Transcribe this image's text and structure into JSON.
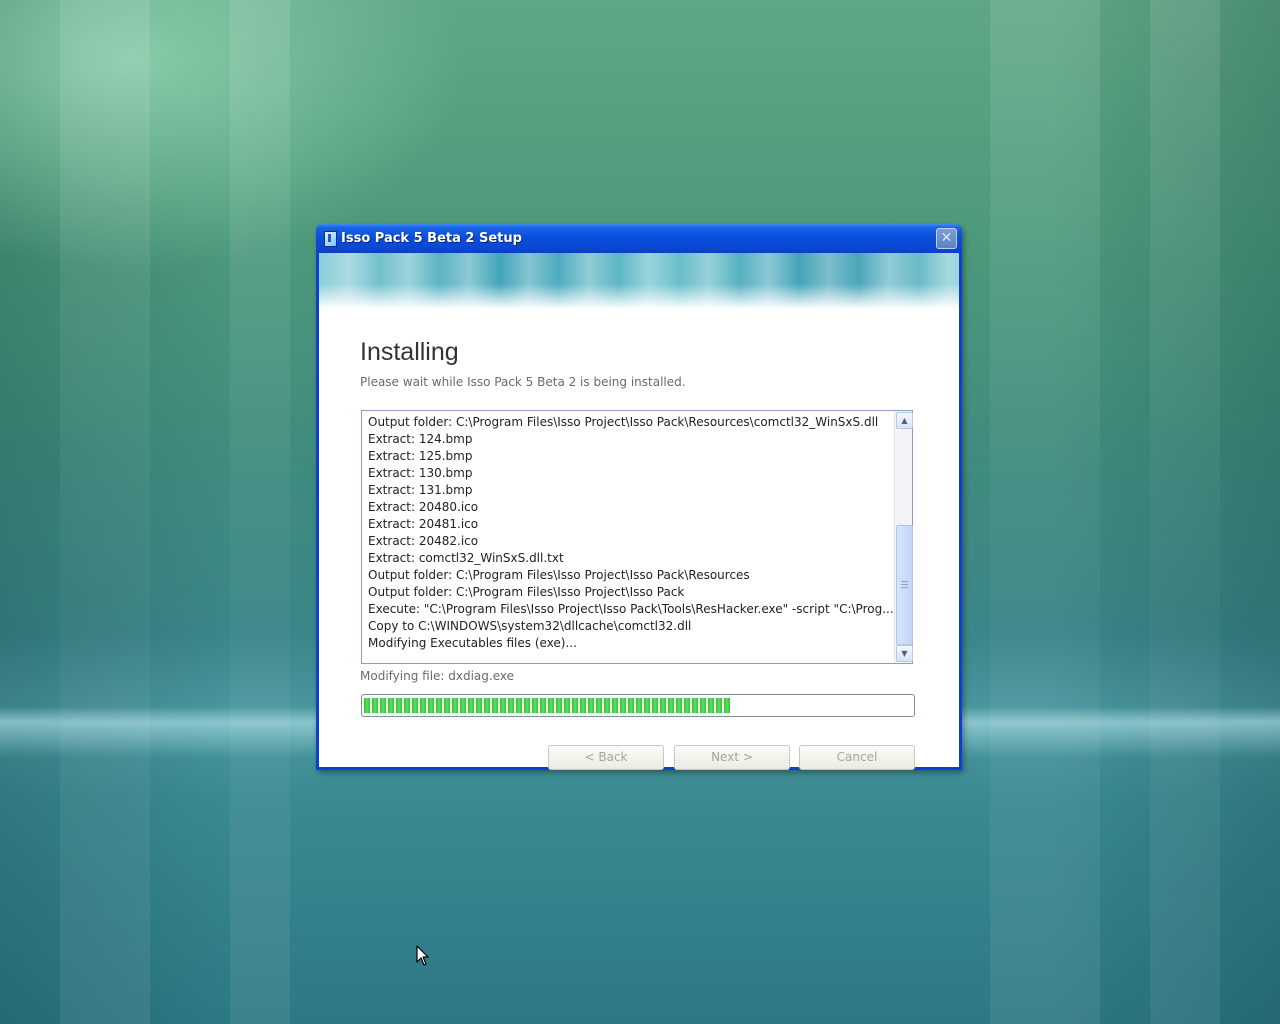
{
  "window": {
    "title": "Isso Pack 5 Beta 2 Setup",
    "close_glyph": "✕"
  },
  "page": {
    "heading": "Installing",
    "subheading": "Please wait while Isso Pack 5 Beta 2 is being installed."
  },
  "log": {
    "lines": [
      "Output folder: C:\\Program Files\\Isso Project\\Isso Pack\\Resources\\comctl32_WinSxS.dll",
      "Extract: 124.bmp",
      "Extract: 125.bmp",
      "Extract: 130.bmp",
      "Extract: 131.bmp",
      "Extract: 20480.ico",
      "Extract: 20481.ico",
      "Extract: 20482.ico",
      "Extract: comctl32_WinSxS.dll.txt",
      "Output folder: C:\\Program Files\\Isso Project\\Isso Pack\\Resources",
      "Output folder: C:\\Program Files\\Isso Project\\Isso Pack",
      "Execute: \"C:\\Program Files\\Isso Project\\Isso Pack\\Tools\\ResHacker.exe\" -script \"C:\\Prog...",
      "Copy to C:\\WINDOWS\\system32\\dllcache\\comctl32.dll",
      "Modifying Executables files (exe)..."
    ],
    "scroll_up_icon": "▲",
    "scroll_down_icon": "▼"
  },
  "status": {
    "text": "Modifying file: dxdiag.exe",
    "progress_fraction": 0.67
  },
  "buttons": {
    "back": "< Back",
    "next": "Next >",
    "cancel": "Cancel"
  },
  "colors": {
    "titlebar": "#0a48d5",
    "progress_green": "#2fc22f",
    "disabled_text": "#a7a69c"
  }
}
